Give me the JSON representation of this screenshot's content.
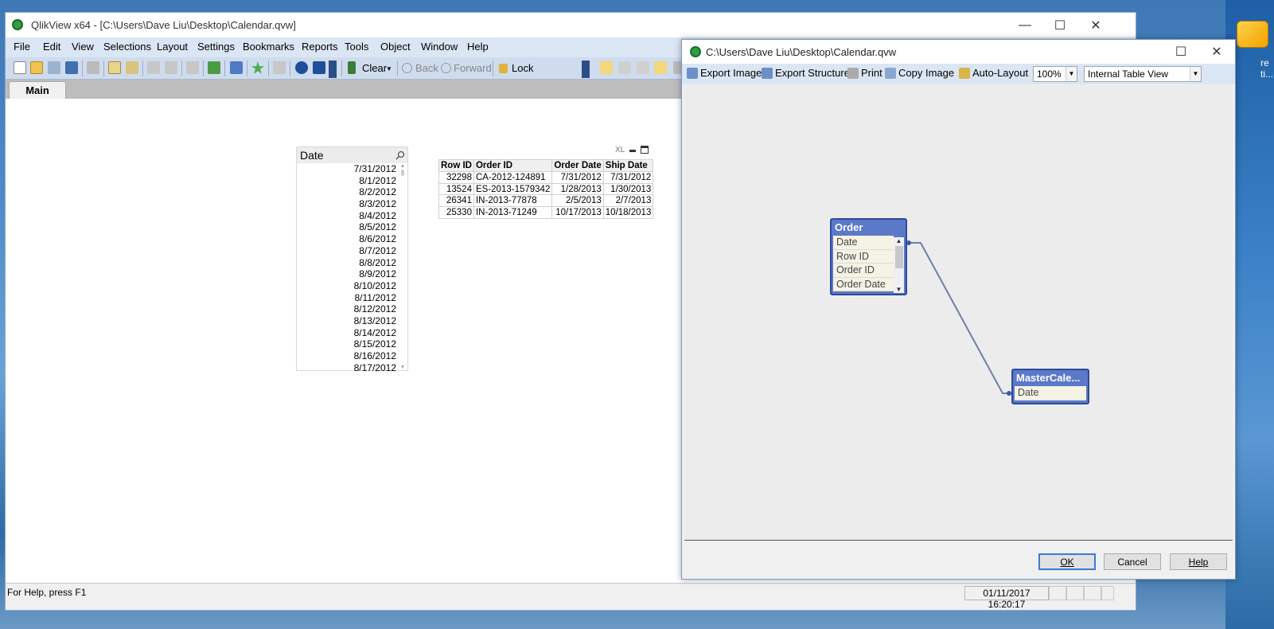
{
  "desktop": {
    "side_text_1": "re",
    "side_text_2": "ti..."
  },
  "main_window": {
    "title": "QlikView x64 - [C:\\Users\\Dave Liu\\Desktop\\Calendar.qvw]",
    "controls": {
      "minimize": "—",
      "maximize": "☐",
      "close": "✕"
    }
  },
  "menu": [
    "File",
    "Edit",
    "View",
    "Selections",
    "Layout",
    "Settings",
    "Bookmarks",
    "Reports",
    "Tools",
    "Object",
    "Window",
    "Help"
  ],
  "toolbar": {
    "clear": "Clear",
    "back": "Back",
    "forward": "Forward",
    "lock": "Lock"
  },
  "tabs": [
    "Main"
  ],
  "listbox": {
    "title": "Date",
    "values": [
      "7/31/2012",
      "8/1/2012",
      "8/2/2012",
      "8/3/2012",
      "8/4/2012",
      "8/5/2012",
      "8/6/2012",
      "8/7/2012",
      "8/8/2012",
      "8/9/2012",
      "8/10/2012",
      "8/11/2012",
      "8/12/2012",
      "8/13/2012",
      "8/14/2012",
      "8/15/2012",
      "8/16/2012",
      "8/17/2012"
    ]
  },
  "tablebox": {
    "caption_icons": "XL",
    "headers": [
      "Row ID",
      "Order ID",
      "Order Date",
      "Ship Date"
    ],
    "rows": [
      [
        "32298",
        "CA-2012-124891",
        "7/31/2012",
        "7/31/2012"
      ],
      [
        "13524",
        "ES-2013-1579342",
        "1/28/2013",
        "1/30/2013"
      ],
      [
        "26341",
        "IN-2013-77878",
        "2/5/2013",
        "2/7/2013"
      ],
      [
        "25330",
        "IN-2013-71249",
        "10/17/2013",
        "10/18/2013"
      ]
    ]
  },
  "status": {
    "help": "For Help, press F1",
    "datetime": "01/11/2017 16:20:17"
  },
  "dialog": {
    "title": "C:\\Users\\Dave Liu\\Desktop\\Calendar.qvw",
    "toolbar": {
      "export_image": "Export Image",
      "export_structure": "Export Structure",
      "print": "Print",
      "copy_image": "Copy Image",
      "auto_layout": "Auto-Layout",
      "zoom": "100%",
      "view": "Internal Table View"
    },
    "tables": [
      {
        "title": "Order",
        "fields": [
          "Date",
          "Row ID",
          "Order ID",
          "Order Date"
        ]
      },
      {
        "title": "MasterCale...",
        "fields": [
          "Date"
        ]
      }
    ],
    "buttons": {
      "ok": "OK",
      "cancel": "Cancel",
      "help": "Help"
    }
  }
}
